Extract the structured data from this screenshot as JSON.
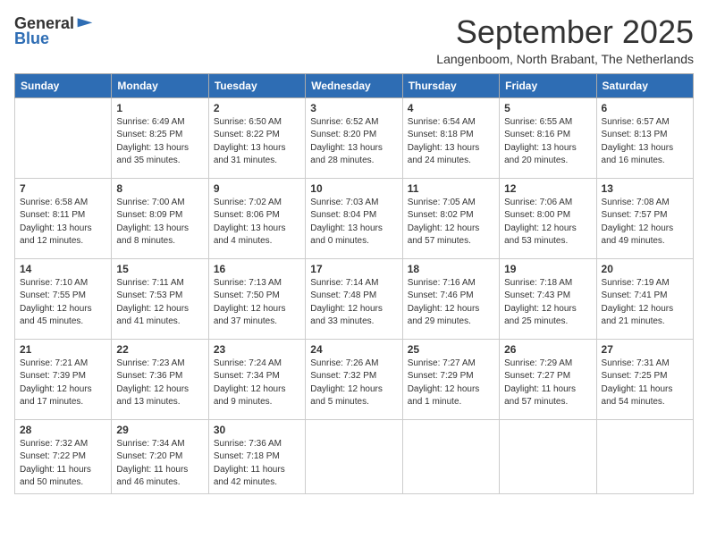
{
  "logo": {
    "text_general": "General",
    "text_blue": "Blue"
  },
  "header": {
    "month_year": "September 2025",
    "location": "Langenboom, North Brabant, The Netherlands"
  },
  "weekdays": [
    "Sunday",
    "Monday",
    "Tuesday",
    "Wednesday",
    "Thursday",
    "Friday",
    "Saturday"
  ],
  "weeks": [
    [
      {
        "day": "",
        "info": ""
      },
      {
        "day": "1",
        "info": "Sunrise: 6:49 AM\nSunset: 8:25 PM\nDaylight: 13 hours\nand 35 minutes."
      },
      {
        "day": "2",
        "info": "Sunrise: 6:50 AM\nSunset: 8:22 PM\nDaylight: 13 hours\nand 31 minutes."
      },
      {
        "day": "3",
        "info": "Sunrise: 6:52 AM\nSunset: 8:20 PM\nDaylight: 13 hours\nand 28 minutes."
      },
      {
        "day": "4",
        "info": "Sunrise: 6:54 AM\nSunset: 8:18 PM\nDaylight: 13 hours\nand 24 minutes."
      },
      {
        "day": "5",
        "info": "Sunrise: 6:55 AM\nSunset: 8:16 PM\nDaylight: 13 hours\nand 20 minutes."
      },
      {
        "day": "6",
        "info": "Sunrise: 6:57 AM\nSunset: 8:13 PM\nDaylight: 13 hours\nand 16 minutes."
      }
    ],
    [
      {
        "day": "7",
        "info": "Sunrise: 6:58 AM\nSunset: 8:11 PM\nDaylight: 13 hours\nand 12 minutes."
      },
      {
        "day": "8",
        "info": "Sunrise: 7:00 AM\nSunset: 8:09 PM\nDaylight: 13 hours\nand 8 minutes."
      },
      {
        "day": "9",
        "info": "Sunrise: 7:02 AM\nSunset: 8:06 PM\nDaylight: 13 hours\nand 4 minutes."
      },
      {
        "day": "10",
        "info": "Sunrise: 7:03 AM\nSunset: 8:04 PM\nDaylight: 13 hours\nand 0 minutes."
      },
      {
        "day": "11",
        "info": "Sunrise: 7:05 AM\nSunset: 8:02 PM\nDaylight: 12 hours\nand 57 minutes."
      },
      {
        "day": "12",
        "info": "Sunrise: 7:06 AM\nSunset: 8:00 PM\nDaylight: 12 hours\nand 53 minutes."
      },
      {
        "day": "13",
        "info": "Sunrise: 7:08 AM\nSunset: 7:57 PM\nDaylight: 12 hours\nand 49 minutes."
      }
    ],
    [
      {
        "day": "14",
        "info": "Sunrise: 7:10 AM\nSunset: 7:55 PM\nDaylight: 12 hours\nand 45 minutes."
      },
      {
        "day": "15",
        "info": "Sunrise: 7:11 AM\nSunset: 7:53 PM\nDaylight: 12 hours\nand 41 minutes."
      },
      {
        "day": "16",
        "info": "Sunrise: 7:13 AM\nSunset: 7:50 PM\nDaylight: 12 hours\nand 37 minutes."
      },
      {
        "day": "17",
        "info": "Sunrise: 7:14 AM\nSunset: 7:48 PM\nDaylight: 12 hours\nand 33 minutes."
      },
      {
        "day": "18",
        "info": "Sunrise: 7:16 AM\nSunset: 7:46 PM\nDaylight: 12 hours\nand 29 minutes."
      },
      {
        "day": "19",
        "info": "Sunrise: 7:18 AM\nSunset: 7:43 PM\nDaylight: 12 hours\nand 25 minutes."
      },
      {
        "day": "20",
        "info": "Sunrise: 7:19 AM\nSunset: 7:41 PM\nDaylight: 12 hours\nand 21 minutes."
      }
    ],
    [
      {
        "day": "21",
        "info": "Sunrise: 7:21 AM\nSunset: 7:39 PM\nDaylight: 12 hours\nand 17 minutes."
      },
      {
        "day": "22",
        "info": "Sunrise: 7:23 AM\nSunset: 7:36 PM\nDaylight: 12 hours\nand 13 minutes."
      },
      {
        "day": "23",
        "info": "Sunrise: 7:24 AM\nSunset: 7:34 PM\nDaylight: 12 hours\nand 9 minutes."
      },
      {
        "day": "24",
        "info": "Sunrise: 7:26 AM\nSunset: 7:32 PM\nDaylight: 12 hours\nand 5 minutes."
      },
      {
        "day": "25",
        "info": "Sunrise: 7:27 AM\nSunset: 7:29 PM\nDaylight: 12 hours\nand 1 minute."
      },
      {
        "day": "26",
        "info": "Sunrise: 7:29 AM\nSunset: 7:27 PM\nDaylight: 11 hours\nand 57 minutes."
      },
      {
        "day": "27",
        "info": "Sunrise: 7:31 AM\nSunset: 7:25 PM\nDaylight: 11 hours\nand 54 minutes."
      }
    ],
    [
      {
        "day": "28",
        "info": "Sunrise: 7:32 AM\nSunset: 7:22 PM\nDaylight: 11 hours\nand 50 minutes."
      },
      {
        "day": "29",
        "info": "Sunrise: 7:34 AM\nSunset: 7:20 PM\nDaylight: 11 hours\nand 46 minutes."
      },
      {
        "day": "30",
        "info": "Sunrise: 7:36 AM\nSunset: 7:18 PM\nDaylight: 11 hours\nand 42 minutes."
      },
      {
        "day": "",
        "info": ""
      },
      {
        "day": "",
        "info": ""
      },
      {
        "day": "",
        "info": ""
      },
      {
        "day": "",
        "info": ""
      }
    ]
  ]
}
